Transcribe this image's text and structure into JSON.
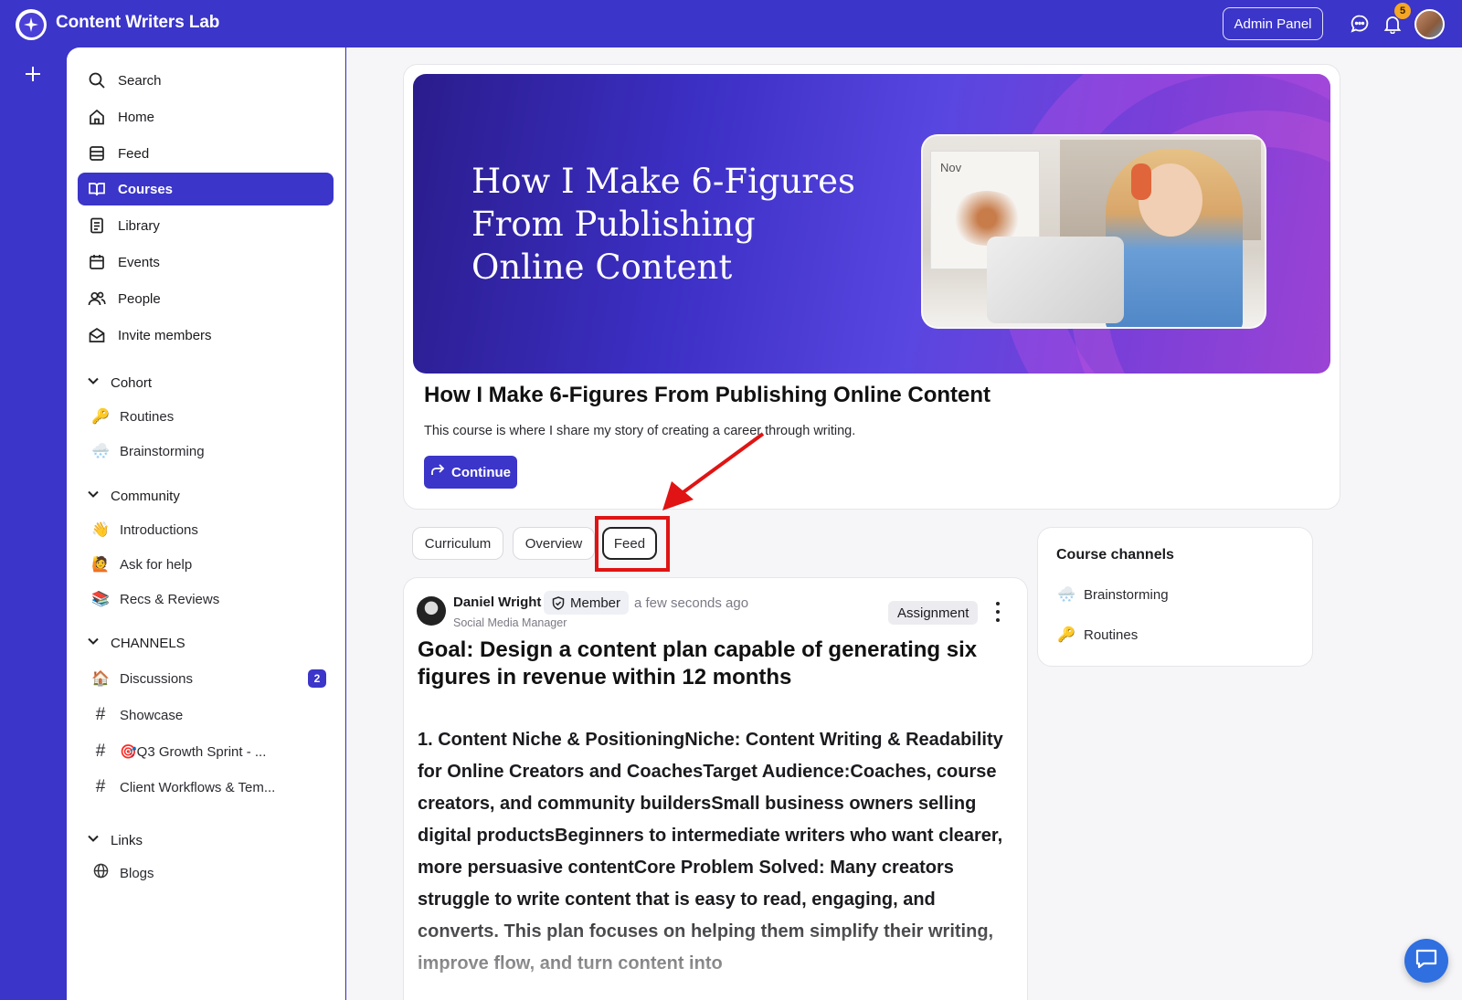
{
  "app": {
    "title": "Content Writers Lab"
  },
  "header": {
    "admin_label": "Admin Panel",
    "notification_count": "5"
  },
  "sidebar": {
    "nav": [
      {
        "label": "Search",
        "icon": "search-icon"
      },
      {
        "label": "Home",
        "icon": "home-icon"
      },
      {
        "label": "Feed",
        "icon": "feed-icon"
      },
      {
        "label": "Courses",
        "icon": "book-icon",
        "active": true
      },
      {
        "label": "Library",
        "icon": "library-icon"
      },
      {
        "label": "Events",
        "icon": "calendar-icon"
      },
      {
        "label": "People",
        "icon": "people-icon"
      },
      {
        "label": "Invite members",
        "icon": "mail-icon"
      }
    ],
    "cohort": {
      "title": "Cohort",
      "items": [
        {
          "label": "Routines",
          "emoji": "🔑"
        },
        {
          "label": "Brainstorming",
          "emoji": "🌨️"
        }
      ]
    },
    "community": {
      "title": "Community",
      "items": [
        {
          "label": "Introductions",
          "emoji": "👋"
        },
        {
          "label": "Ask for help",
          "emoji": "🙋"
        },
        {
          "label": "Recs & Reviews",
          "emoji": "📚"
        }
      ]
    },
    "channels": {
      "title": "CHANNELS",
      "items": [
        {
          "label": "Discussions",
          "emoji": "🏠",
          "count": "2"
        },
        {
          "label": "Showcase",
          "emoji": "#"
        },
        {
          "label": "🎯Q3 Growth Sprint - ...",
          "emoji": "#"
        },
        {
          "label": "Client Workflows & Tem...",
          "emoji": "#"
        }
      ]
    },
    "links": {
      "title": "Links",
      "items": [
        {
          "label": "Blogs",
          "icon": "globe-icon"
        }
      ]
    }
  },
  "course": {
    "banner_title": "How I Make 6-Figures From Publishing Online Content",
    "banner_calendar_label": "Nov",
    "title": "How I Make 6-Figures From Publishing Online Content",
    "description": "This course is where I share my story of creating a career through writing.",
    "continue_label": "Continue"
  },
  "tabs": [
    {
      "label": "Curriculum"
    },
    {
      "label": "Overview"
    },
    {
      "label": "Feed",
      "selected": true
    }
  ],
  "post": {
    "author": "Daniel Wright",
    "member_label": "Member",
    "time": "a few seconds ago",
    "role": "Social Media Manager",
    "tag": "Assignment",
    "title": "Goal: Design a content plan capable of generating six figures in revenue within 12 months",
    "body": "1. Content Niche & PositioningNiche: Content Writing & Readability for Online Creators and CoachesTarget Audience:Coaches, course creators, and community buildersSmall business owners selling digital productsBeginners to intermediate writers who want clearer, more persuasive contentCore Problem Solved: Many creators struggle to write content that is easy to read, engaging, and converts. This plan focuses on helping them simplify their writing, improve flow, and turn content into"
  },
  "course_channels": {
    "title": "Course channels",
    "items": [
      {
        "label": "Brainstorming",
        "emoji": "🌨️"
      },
      {
        "label": "Routines",
        "emoji": "🔑"
      }
    ]
  },
  "colors": {
    "brand": "#3b35c9",
    "annotation": "#e01414",
    "notification_badge": "#f5a623"
  }
}
